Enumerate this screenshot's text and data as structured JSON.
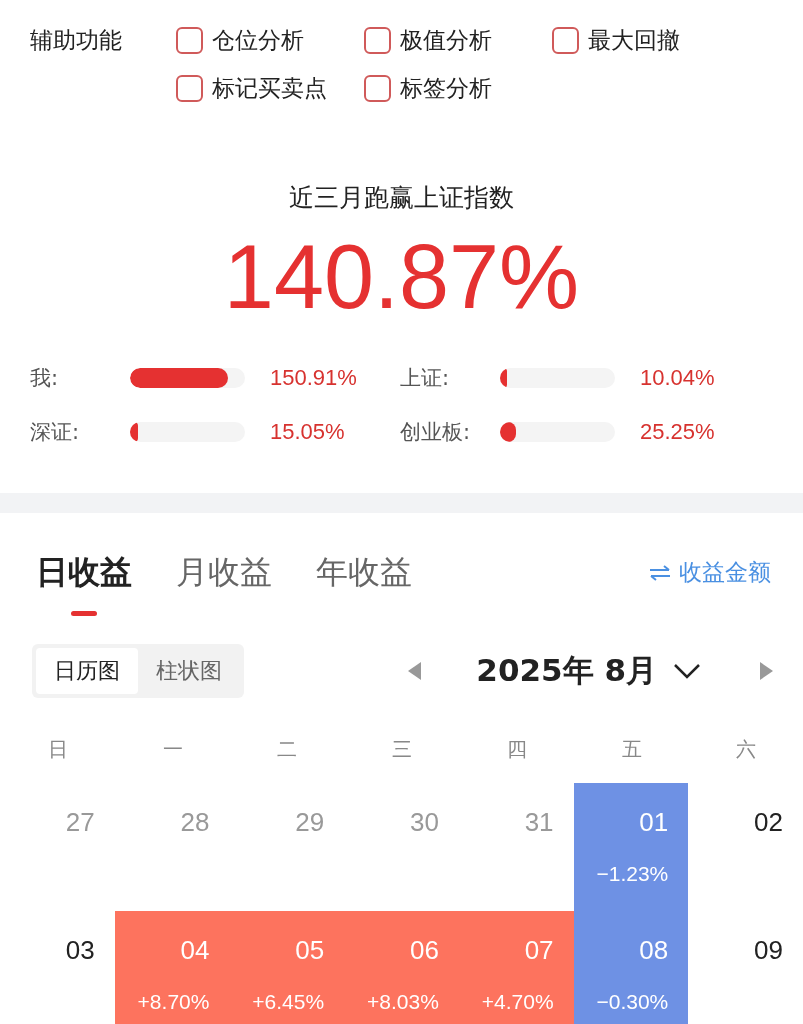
{
  "aux": {
    "label": "辅助功能",
    "options": [
      {
        "label": "仓位分析",
        "checked": false
      },
      {
        "label": "极值分析",
        "checked": false
      },
      {
        "label": "最大回撤",
        "checked": false
      },
      {
        "label": "标记买卖点",
        "checked": false
      },
      {
        "label": "标签分析",
        "checked": false
      }
    ]
  },
  "summary": {
    "title": "近三月跑赢上证指数",
    "value": "140.87%"
  },
  "comparisons": [
    {
      "label": "我:",
      "level": 0.85,
      "value": "150.91%"
    },
    {
      "label": "上证:",
      "level": 0.06,
      "value": "10.04%"
    },
    {
      "label": "深证:",
      "level": 0.07,
      "value": "15.05%"
    },
    {
      "label": "创业板:",
      "level": 0.14,
      "value": "25.25%"
    }
  ],
  "tabs": [
    {
      "label": "日收益",
      "selected": true
    },
    {
      "label": "月收益",
      "selected": false
    },
    {
      "label": "年收益",
      "selected": false
    }
  ],
  "toggle_link": "收益金额",
  "view_switch": [
    {
      "label": "日历图",
      "selected": true
    },
    {
      "label": "柱状图",
      "selected": false
    }
  ],
  "month": "2025年 8月",
  "weekdays": [
    "日",
    "一",
    "二",
    "三",
    "四",
    "五",
    "六"
  ],
  "days": [
    {
      "day": "27",
      "kind": "outside"
    },
    {
      "day": "28",
      "kind": "outside"
    },
    {
      "day": "29",
      "kind": "outside"
    },
    {
      "day": "30",
      "kind": "outside"
    },
    {
      "day": "31",
      "kind": "outside"
    },
    {
      "day": "01",
      "kind": "loss",
      "change": "−1.23%"
    },
    {
      "day": "02",
      "kind": "plain"
    },
    {
      "day": "03",
      "kind": "plain"
    },
    {
      "day": "04",
      "kind": "gain",
      "change": "+8.70%"
    },
    {
      "day": "05",
      "kind": "gain",
      "change": "+6.45%"
    },
    {
      "day": "06",
      "kind": "gain",
      "change": "+8.03%"
    },
    {
      "day": "07",
      "kind": "gain",
      "change": "+4.70%"
    },
    {
      "day": "08",
      "kind": "loss",
      "change": "−0.30%"
    },
    {
      "day": "09",
      "kind": "plain"
    }
  ]
}
